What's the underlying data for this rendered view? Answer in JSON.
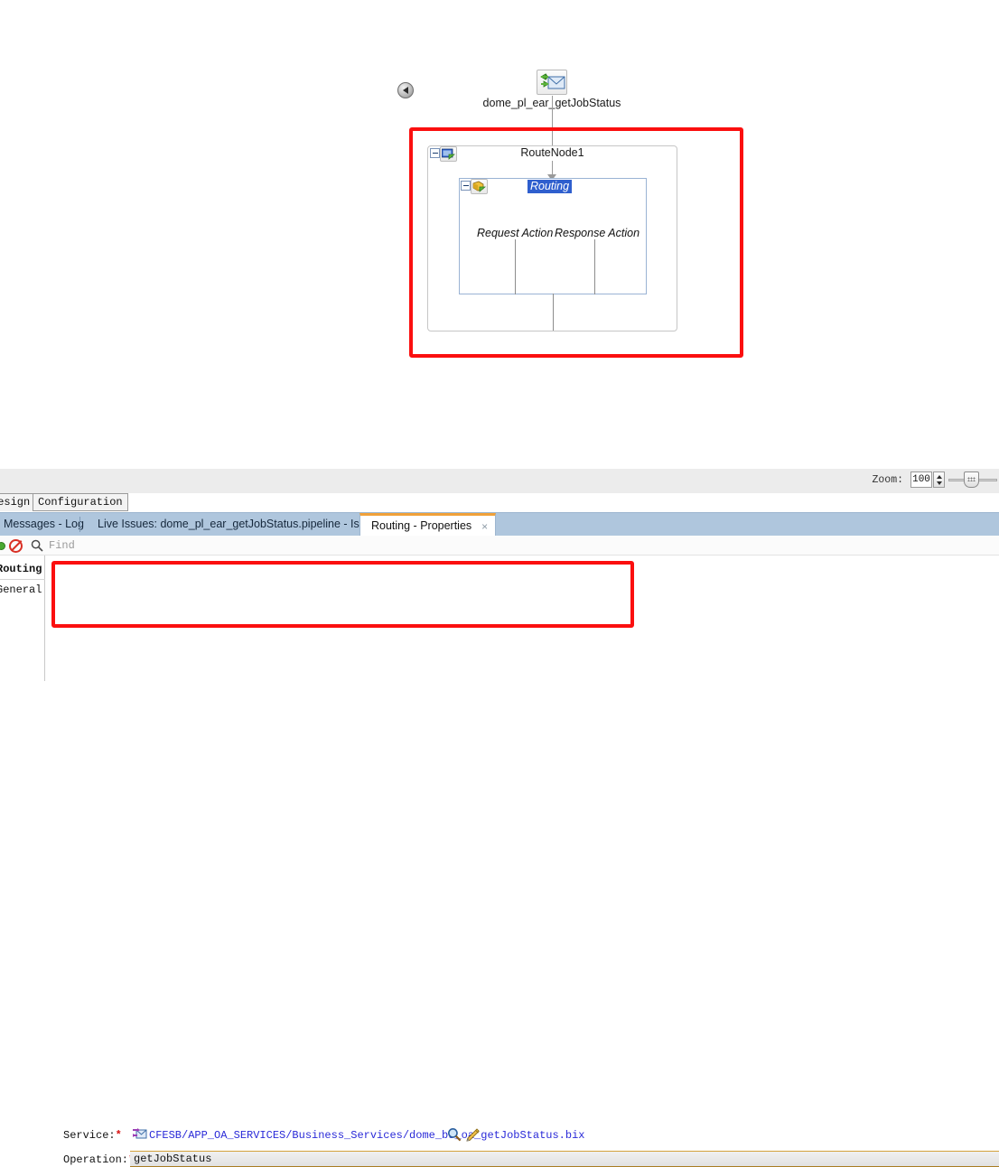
{
  "canvas": {
    "service_node": {
      "label": "dome_pl_ear_getJobStatus",
      "icon": "message-exchange-icon"
    },
    "collapse_button": "collapse-left-icon",
    "route_node": {
      "title": "RouteNode1",
      "icon": "route-node-icon",
      "expander": "collapse-minus-icon"
    },
    "routing": {
      "title": "Routing",
      "icon": "routing-icon",
      "expander": "collapse-minus-icon",
      "request_action_label": "Request Action",
      "response_action_label": "Response Action"
    },
    "annotation_color": "#fb0f0f"
  },
  "zoombar": {
    "label": "Zoom:",
    "value": "100",
    "spinner_up": "spinner-up-icon",
    "spinner_down": "spinner-down-icon",
    "slider": "zoom-slider"
  },
  "editor_tabs": [
    {
      "label": "Design",
      "active": true
    },
    {
      "label": "Configuration",
      "active": false
    }
  ],
  "dock_tabs": [
    {
      "label": "Messages - Log",
      "active": false
    },
    {
      "label": "Live Issues: dome_pl_ear_getJobStatus.pipeline - Issues",
      "active": false
    },
    {
      "label": "Routing - Properties",
      "active": true,
      "close": "×"
    }
  ],
  "findbar": {
    "status_ok_icon": "status-ok-icon",
    "block_icon": "no-entry-icon",
    "search_icon": "search-icon",
    "placeholder": "Find"
  },
  "properties": {
    "side_nav": [
      {
        "label": "Routing",
        "selected": true
      },
      {
        "label": "General",
        "selected": false
      }
    ],
    "service": {
      "label": "Service:",
      "required_marker": "*",
      "icon": "business-service-icon",
      "value": "CFESB/APP_OA_SERVICES/Business_Services/dome_bs_oa_getJobStatus.bix",
      "browse_icon": "search-icon",
      "clear_icon": "eraser-icon"
    },
    "operation": {
      "label": "Operation:",
      "required_marker": "*",
      "value": "getJobStatus"
    },
    "annotation_color": "#fb0f0f"
  }
}
